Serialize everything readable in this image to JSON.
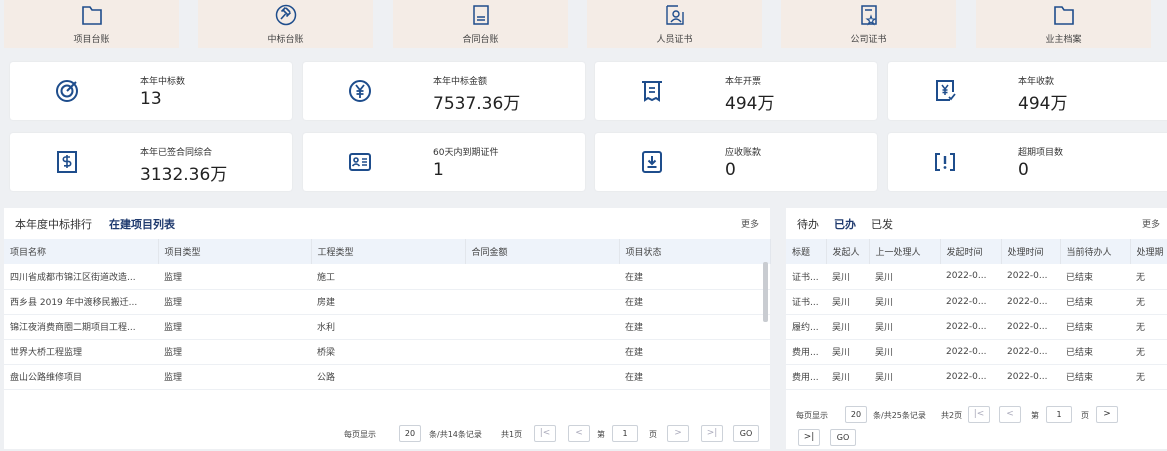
{
  "quick_nav": [
    {
      "label": "项目台账",
      "icon": "folder-icon"
    },
    {
      "label": "中标台账",
      "icon": "gavel-icon"
    },
    {
      "label": "合同台账",
      "icon": "contract-icon"
    },
    {
      "label": "人员证书",
      "icon": "person-cert-icon"
    },
    {
      "label": "公司证书",
      "icon": "company-cert-icon"
    },
    {
      "label": "业主档案",
      "icon": "folder-icon"
    }
  ],
  "stats": [
    {
      "label": "本年中标数",
      "value": "13",
      "icon": "target-icon"
    },
    {
      "label": "本年中标金额",
      "value": "7537.36万",
      "icon": "yen-circle-icon"
    },
    {
      "label": "本年开票",
      "value": "494万",
      "icon": "receipt-icon"
    },
    {
      "label": "本年收款",
      "value": "494万",
      "icon": "payment-received-icon"
    },
    {
      "label": "本年已签合同综合",
      "value": "3132.36万",
      "icon": "dollar-doc-icon"
    },
    {
      "label": "60天内到期证件",
      "value": "1",
      "icon": "id-card-icon"
    },
    {
      "label": "应收账款",
      "value": "0",
      "icon": "receivable-icon"
    },
    {
      "label": "超期项目数",
      "value": "0",
      "icon": "alert-box-icon"
    }
  ],
  "left_panel": {
    "tabs": [
      "本年度中标排行",
      "在建项目列表"
    ],
    "active_tab": 1,
    "more": "更多",
    "columns": [
      "项目名称",
      "项目类型",
      "工程类型",
      "合同金额",
      "项目状态"
    ],
    "rows": [
      [
        "四川省成都市锦江区街道改造...",
        "监理",
        "施工",
        "",
        "在建"
      ],
      [
        "西乡县 2019 年中渡移民搬迁...",
        "监理",
        "房建",
        "",
        "在建"
      ],
      [
        "锦江夜消费商圈二期项目工程...",
        "监理",
        "水利",
        "",
        "在建"
      ],
      [
        "世界大桥工程监理",
        "监理",
        "桥梁",
        "",
        "在建"
      ],
      [
        "盘山公路维修项目",
        "监理",
        "公路",
        "",
        "在建"
      ]
    ],
    "pager": {
      "per_page_label": "每页显示",
      "per_page": "20",
      "summary": "条/共14条记录",
      "total_pages": "共1页",
      "page_label": "第",
      "page": "1",
      "page_suffix": "页",
      "go": "GO"
    }
  },
  "right_panel": {
    "tabs": [
      "待办",
      "已办",
      "已发"
    ],
    "active_tab": 1,
    "more": "更多",
    "columns": [
      "标题",
      "发起人",
      "上一处理人",
      "发起时间",
      "处理时间",
      "当前待办人",
      "处理期"
    ],
    "rows": [
      [
        "证书...",
        "吴川",
        "吴川",
        "2022-0...",
        "2022-0...",
        "已结束",
        "无"
      ],
      [
        "证书...",
        "吴川",
        "吴川",
        "2022-0...",
        "2022-0...",
        "已结束",
        "无"
      ],
      [
        "履约...",
        "吴川",
        "吴川",
        "2022-0...",
        "2022-0...",
        "已结束",
        "无"
      ],
      [
        "费用...",
        "吴川",
        "吴川",
        "2022-0...",
        "2022-0...",
        "已结束",
        "无"
      ],
      [
        "费用...",
        "吴川",
        "吴川",
        "2022-0...",
        "2022-0...",
        "已结束",
        "无"
      ]
    ],
    "pager": {
      "per_page_label": "每页显示",
      "per_page": "20",
      "summary": "条/共25条记录",
      "total_pages": "共2页",
      "page_label": "第",
      "page": "1",
      "page_suffix": "页",
      "go": "GO"
    }
  },
  "colors": {
    "accent": "#1f3a6e",
    "icon": "#1e4d8c",
    "nav_bg": "#f4ece6",
    "header_bg": "#eef3fa"
  }
}
